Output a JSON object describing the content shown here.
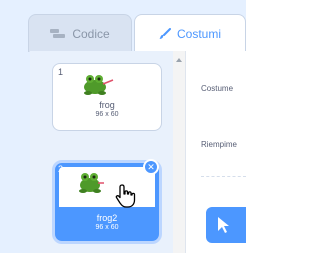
{
  "tabs": {
    "code_label": "Codice",
    "costumes_label": "Costumi"
  },
  "costumes": [
    {
      "number": "1",
      "name": "frog",
      "size": "96 x 60"
    },
    {
      "number": "2",
      "name": "frog2",
      "size": "96 x 60"
    }
  ],
  "editor": {
    "costume_label": "Costume",
    "fill_label": "Riempime"
  },
  "icons": {
    "code_tab": "code-blocks-icon",
    "costumes_tab": "brush-icon",
    "delete": "close-icon",
    "cursor": "pointer-cursor-icon",
    "select_tool": "arrow-select-icon"
  },
  "colors": {
    "accent": "#4c97ff",
    "background": "#e5f0ff",
    "text": "#575e75"
  }
}
